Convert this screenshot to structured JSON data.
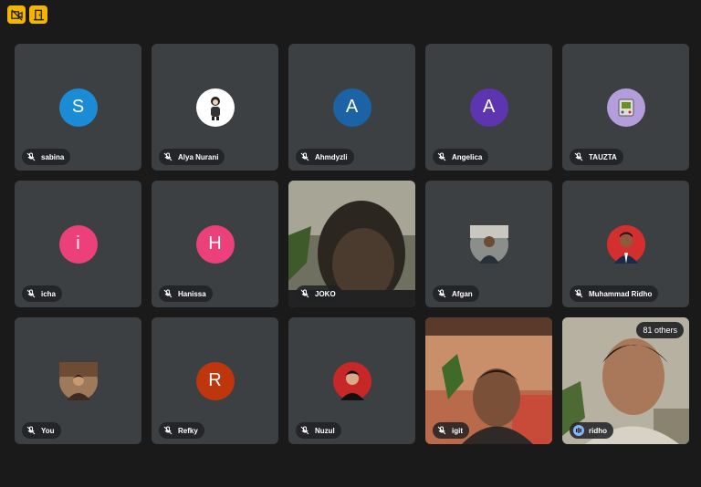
{
  "toolbar": {
    "button1_icon": "camera-off-icon",
    "button2_icon": "exit-door-icon"
  },
  "participants": [
    {
      "name": "sabina",
      "avatar_letter": "S",
      "avatar_color": "#1a8bd4",
      "mic": "muted"
    },
    {
      "name": "Alya Nurani",
      "avatar_letter": "",
      "avatar_color": "#ffffff",
      "mic": "muted"
    },
    {
      "name": "Ahmdyzli",
      "avatar_letter": "A",
      "avatar_color": "#1c63a5",
      "mic": "muted"
    },
    {
      "name": "Angelica",
      "avatar_letter": "A",
      "avatar_color": "#5e35b1",
      "mic": "muted"
    },
    {
      "name": "TAUZTA",
      "avatar_letter": "",
      "avatar_color": "#b39ddb",
      "mic": "muted"
    },
    {
      "name": "icha",
      "avatar_letter": "i",
      "avatar_color": "#ec407a",
      "mic": "muted"
    },
    {
      "name": "Hanissa",
      "avatar_letter": "H",
      "avatar_color": "#ec407a",
      "mic": "muted"
    },
    {
      "name": "JOKO",
      "avatar_letter": "",
      "avatar_color": "",
      "mic": "muted"
    },
    {
      "name": "Afgan",
      "avatar_letter": "",
      "avatar_color": "#607d8b",
      "mic": "muted"
    },
    {
      "name": "Muhammad Ridho",
      "avatar_letter": "",
      "avatar_color": "#d32f2f",
      "mic": "muted"
    },
    {
      "name": "You",
      "avatar_letter": "",
      "avatar_color": "#8d6e63",
      "mic": "muted"
    },
    {
      "name": "Refky",
      "avatar_letter": "R",
      "avatar_color": "#c0360c",
      "mic": "muted"
    },
    {
      "name": "Nuzul",
      "avatar_letter": "",
      "avatar_color": "#c62828",
      "mic": "muted"
    },
    {
      "name": "igit",
      "avatar_letter": "",
      "avatar_color": "",
      "mic": "muted"
    },
    {
      "name": "ridho",
      "avatar_letter": "",
      "avatar_color": "",
      "mic": "speaking"
    }
  ],
  "overflow": {
    "label": "81 others"
  }
}
